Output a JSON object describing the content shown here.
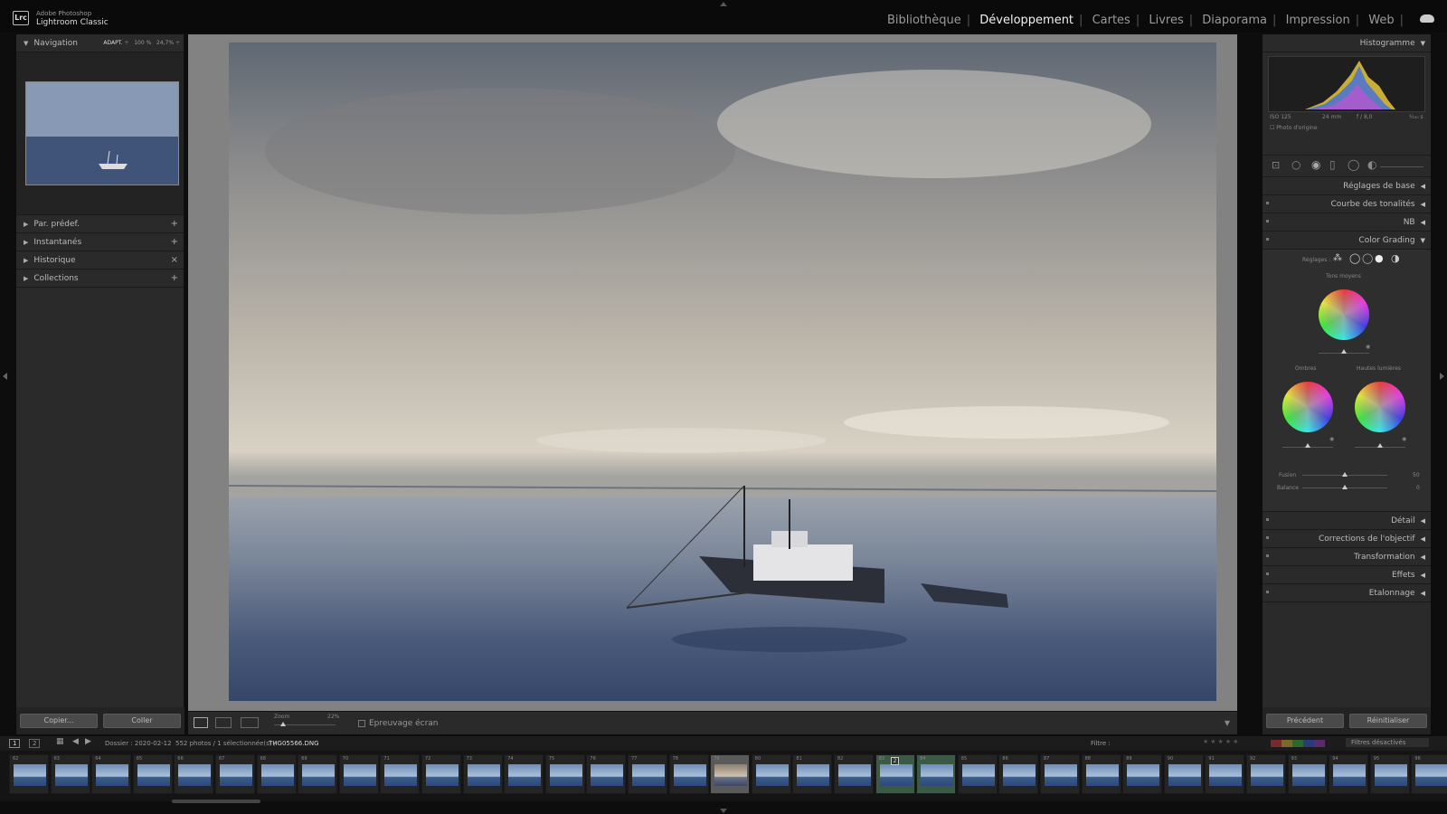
{
  "app": {
    "line1": "Adobe Photoshop",
    "line2": "Lightroom Classic",
    "logo": "Lrc"
  },
  "modules": [
    "Bibliothèque",
    "Développement",
    "Cartes",
    "Livres",
    "Diaporama",
    "Impression",
    "Web"
  ],
  "active_module": "Développement",
  "left": {
    "navigator": {
      "title": "Navigation",
      "fit": "ADAPT.",
      "z1": "100 %",
      "z2": "24,7%"
    },
    "panels": [
      {
        "label": "Par. prédef.",
        "action": "+"
      },
      {
        "label": "Instantanés",
        "action": "+"
      },
      {
        "label": "Historique",
        "action": "×"
      },
      {
        "label": "Collections",
        "action": "+"
      }
    ],
    "copy": "Copier...",
    "paste": "Coller"
  },
  "toolbar": {
    "zoom_label": "Zoom",
    "zoom_value": "22%",
    "softproof": "Epreuvage écran"
  },
  "right": {
    "histogram": {
      "title": "Histogramme",
      "iso": "ISO 125",
      "focal": "24 mm",
      "aperture": "f / 8,0",
      "shutter": "¹⁄₂₅₀ s",
      "original": "Photo d'origine"
    },
    "panels_top": [
      "Réglages de base",
      "Courbe des tonalités",
      "NB"
    ],
    "color_grading": {
      "title": "Color Grading",
      "reglages": "Réglages :",
      "midtones": "Tons moyens",
      "shadows": "Ombres",
      "highlights": "Hautes lumières",
      "fusion_label": "Fusion",
      "fusion_value": "50",
      "balance_label": "Balance",
      "balance_value": "0"
    },
    "panels_bottom": [
      "Détail",
      "Corrections de l'objectif",
      "Transformation",
      "Effets",
      "Etalonnage"
    ],
    "prev": "Précédent",
    "reset": "Réinitialiser"
  },
  "filmbar": {
    "p1": "1",
    "p2": "2",
    "source": "Dossier : 2020-02-12",
    "count": "552 photos / 1 sélectionnée(s) /",
    "file": "THG05566.DNG",
    "filter": "Filtre :",
    "filters_off": "Filtres désactivés"
  },
  "film_numbers": [
    "62",
    "63",
    "64",
    "65",
    "66",
    "67",
    "68",
    "69",
    "70",
    "71",
    "72",
    "73",
    "74",
    "75",
    "76",
    "77",
    "78",
    "79",
    "80",
    "81",
    "82",
    "83",
    "84",
    "85",
    "86",
    "87",
    "88",
    "89",
    "90",
    "91",
    "92",
    "93",
    "94",
    "95",
    "96",
    "97"
  ],
  "film_stack_badge": "2"
}
